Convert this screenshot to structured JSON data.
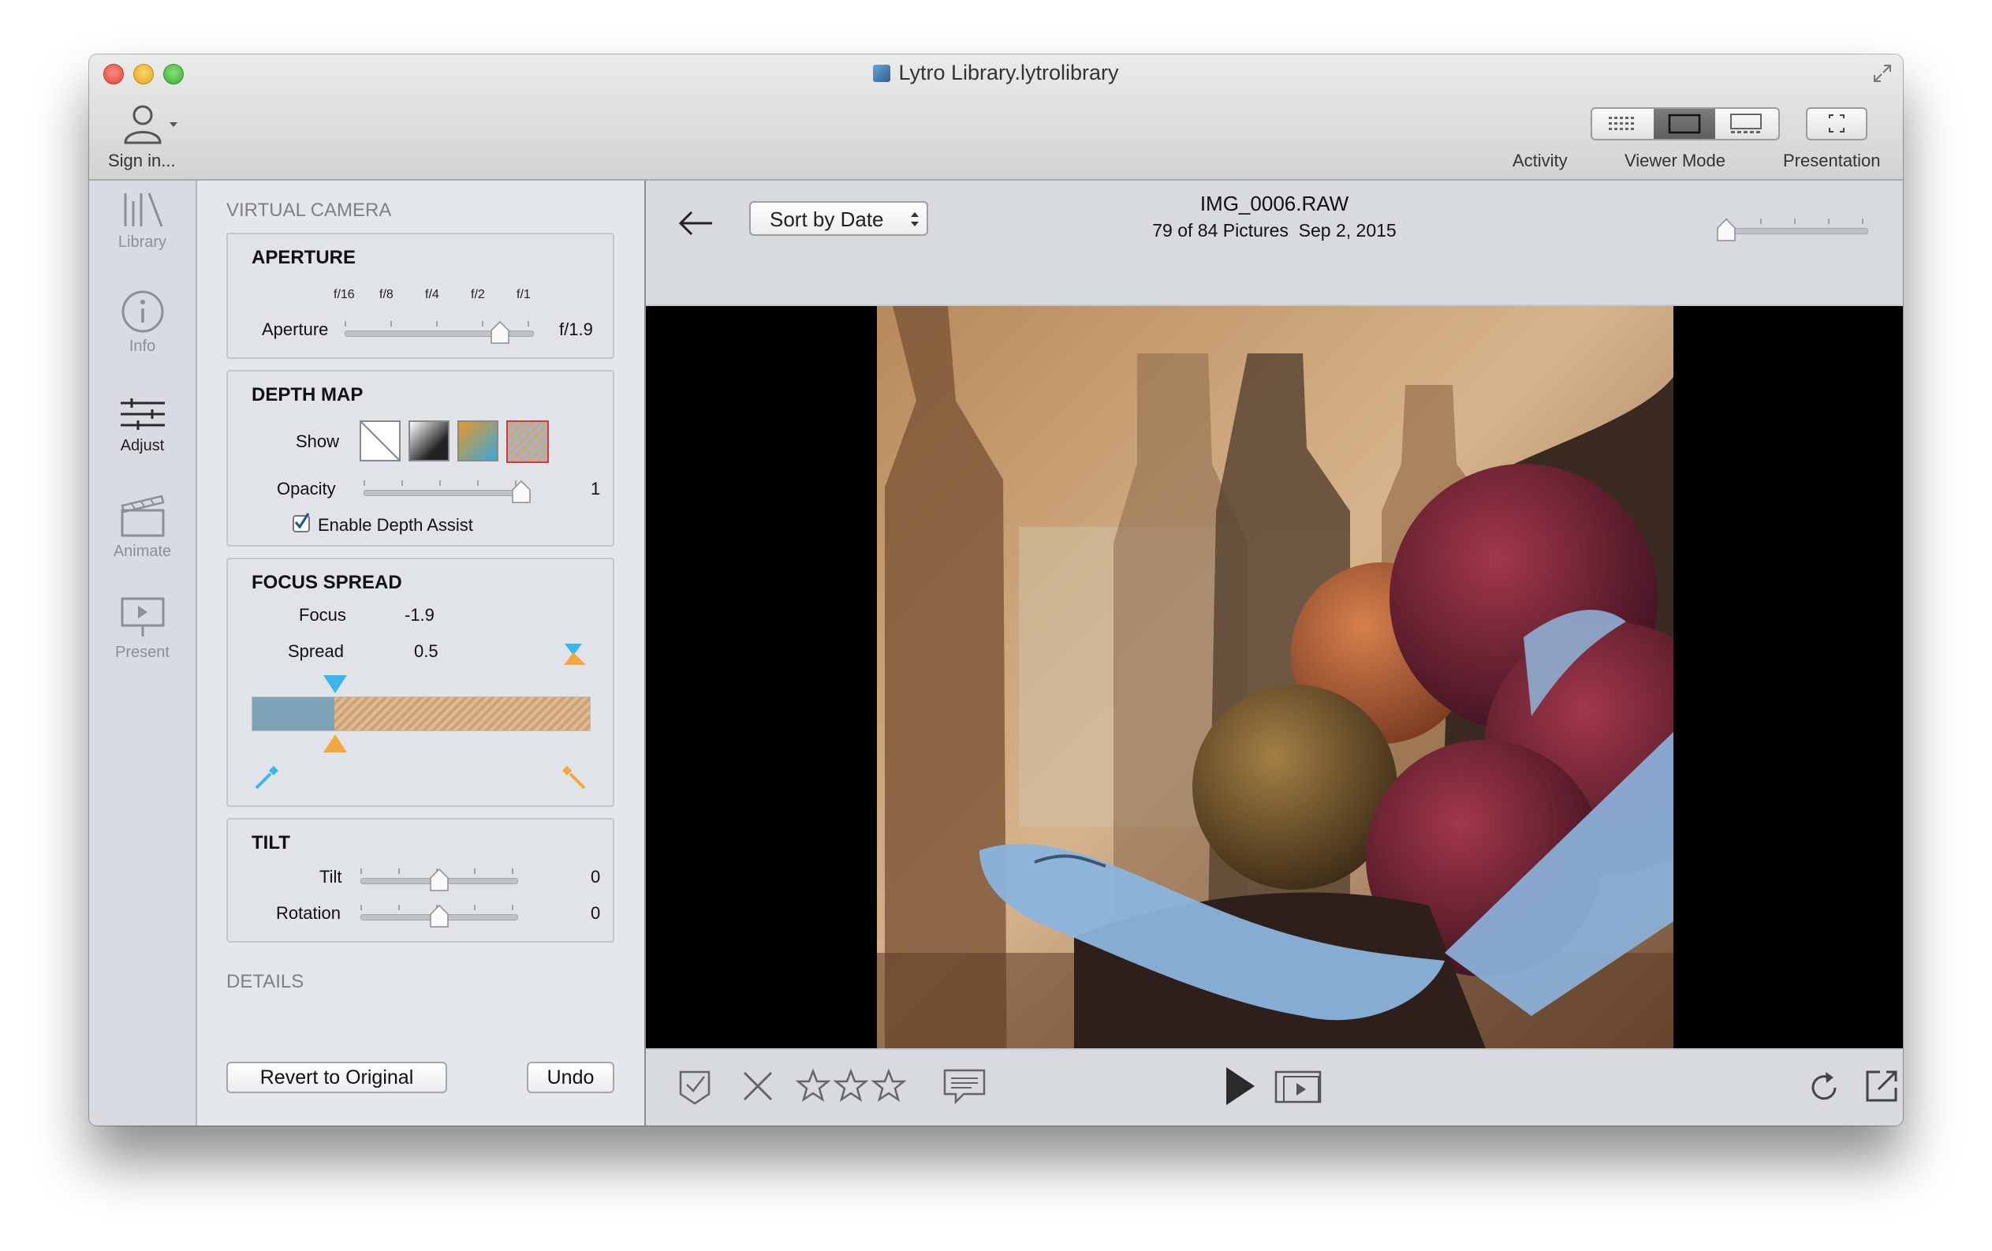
{
  "window": {
    "title": "Lytro Library.lytrolibrary",
    "sign_in": "Sign in..."
  },
  "toolbar": {
    "activity_label": "Activity",
    "viewer_mode_label": "Viewer Mode",
    "presentation_label": "Presentation"
  },
  "sidebar": {
    "items": [
      {
        "label": "Library",
        "icon": "library-icon",
        "active": false
      },
      {
        "label": "Info",
        "icon": "info-icon",
        "active": false
      },
      {
        "label": "Adjust",
        "icon": "sliders-icon",
        "active": true
      },
      {
        "label": "Animate",
        "icon": "clapper-icon",
        "active": false
      },
      {
        "label": "Present",
        "icon": "presentation-icon",
        "active": false
      }
    ]
  },
  "panel": {
    "heading": "VIRTUAL CAMERA",
    "aperture": {
      "title": "APERTURE",
      "label": "Aperture",
      "scale": [
        "f/16",
        "f/8",
        "f/4",
        "f/2",
        "f/1"
      ],
      "value": "f/1.9",
      "level": 0.82
    },
    "depth_map": {
      "title": "DEPTH MAP",
      "show_label": "Show",
      "opacity_label": "Opacity",
      "opacity_value": "1",
      "opacity_level": 1.0,
      "checkbox_label": "Enable Depth Assist",
      "checkbox_checked": true
    },
    "focus_spread": {
      "title": "FOCUS SPREAD",
      "focus_label": "Focus",
      "focus_value": "-1.9",
      "spread_label": "Spread",
      "spread_value": "0.5"
    },
    "tilt": {
      "title": "TILT",
      "tilt_label": "Tilt",
      "tilt_value": "0",
      "tilt_level": 0.5,
      "rotation_label": "Rotation",
      "rotation_value": "0",
      "rotation_level": 0.5
    },
    "details_heading": "DETAILS",
    "revert_button": "Revert to Original",
    "undo_button": "Undo"
  },
  "viewer": {
    "sort_label": "Sort by Date",
    "filename": "IMG_0006.RAW",
    "count_text": "79 of 84 Pictures",
    "date_text": "Sep 2, 2015",
    "zoom_level": 0.0
  },
  "colors": {
    "depth_blue": "#7fa3c7",
    "depth_orange": "#e9a24e",
    "marker_blue": "#3ab6ea",
    "marker_orange": "#f5a63c"
  }
}
